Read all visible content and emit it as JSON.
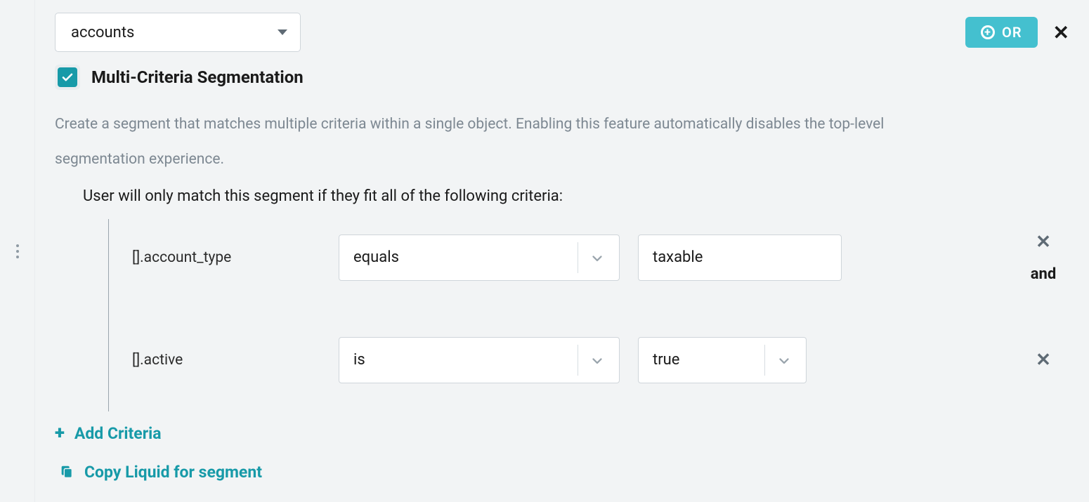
{
  "header": {
    "object_select": "accounts",
    "or_button": "OR"
  },
  "checkbox": {
    "checked": true,
    "label": "Multi-Criteria Segmentation"
  },
  "help_text": "Create a segment that matches multiple criteria within a single object. Enabling this feature automatically disables the top-level segmentation experience.",
  "instruction": "User will only match this segment if they fit all of the following criteria:",
  "criteria": [
    {
      "field": "[].account_type",
      "operator": "equals",
      "value": "taxable",
      "value_is_dropdown": false,
      "conjunction": "and"
    },
    {
      "field": "[].active",
      "operator": "is",
      "value": "true",
      "value_is_dropdown": true,
      "conjunction": ""
    }
  ],
  "actions": {
    "add_criteria": "Add Criteria",
    "copy_liquid": "Copy Liquid for segment"
  }
}
